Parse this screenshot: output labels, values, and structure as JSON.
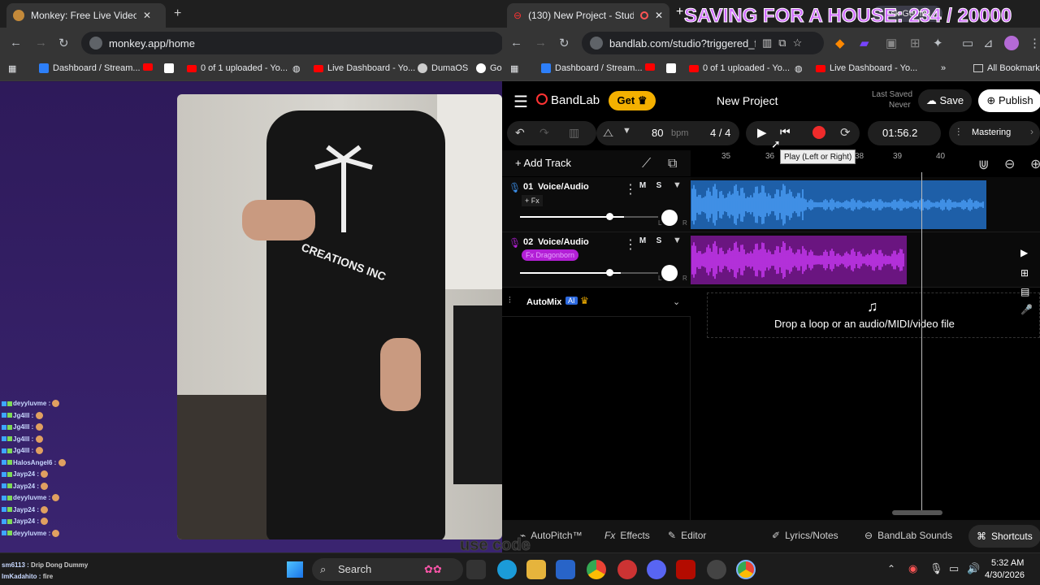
{
  "left_browser": {
    "tab_title": "Monkey: Free Live Video Ch",
    "url": "monkey.app/home",
    "bookmarks": [
      "Dashboard / Stream...",
      "0 of 1 uploaded - Yo...",
      "Live Dashboard - Yo...",
      "DumaOS",
      "Go"
    ]
  },
  "shirt_text": "CREATIONS INC",
  "chat": [
    {
      "user": "deyyluvme :",
      "msg": ""
    },
    {
      "user": "Jg4lll :",
      "msg": ""
    },
    {
      "user": "Jg4lll :",
      "msg": ""
    },
    {
      "user": "Jg4lll :",
      "msg": ""
    },
    {
      "user": "Jg4lll :",
      "msg": ""
    },
    {
      "user": "HalosAngel6 :",
      "msg": ""
    },
    {
      "user": "Jayp24 :",
      "msg": ""
    },
    {
      "user": "Jayp24 :",
      "msg": ""
    },
    {
      "user": "deyyluvme :",
      "msg": ""
    },
    {
      "user": "Jayp24 :",
      "msg": ""
    },
    {
      "user": "Jayp24 :",
      "msg": ""
    },
    {
      "user": "deyyluvme :",
      "msg": ""
    },
    {
      "user": "sm6113 :",
      "msg": "Drip Dong Dummy"
    },
    {
      "user": "lmKadahito :",
      "msg": "fire"
    }
  ],
  "overlay_text": "use code",
  "right_browser": {
    "tab_count_title": "(130) New Project - Studio",
    "url": "bandlab.com/studio?triggered_fr...",
    "stream_overlay": "SAVING FOR A HOUSE: 234 / 20000",
    "ask_gemini": "Ask Gemini",
    "bookmarks": [
      "Dashboard / Stream...",
      "0 of 1 uploaded - Yo...",
      "Live Dashboard - Yo..."
    ],
    "all_bookmarks": "All Bookmarks"
  },
  "bandlab": {
    "brand": "BandLab",
    "get_label": "Get",
    "project_name": "New Project",
    "last_saved_label": "Last Saved",
    "last_saved_value": "Never",
    "save_label": "Save",
    "publish_label": "Publish",
    "bpm_value": "80",
    "bpm_unit": "bpm",
    "time_sig": "4 / 4",
    "time": "01:56.2",
    "mastering_label": "Mastering",
    "tooltip": "Play (Left or Right)",
    "add_track_label": "Add Track",
    "ruler": [
      "35",
      "36",
      "38",
      "39",
      "40"
    ],
    "tracks": [
      {
        "num": "01",
        "name": "Voice/Audio",
        "fx": "+ Fx",
        "color": "#3b8ee8",
        "vol": 0.75
      },
      {
        "num": "02",
        "name": "Voice/Audio",
        "fx": "Fx Dragonborn",
        "color": "#b31fd6",
        "vol": 0.73
      }
    ],
    "automix_label": "AutoMix",
    "ai_badge": "AI",
    "drop_text": "Drop a loop or an audio/MIDI/video file",
    "bottom_tools": [
      "AutoPitch™",
      "Effects",
      "Editor",
      "Lyrics/Notes",
      "BandLab Sounds",
      "Shortcuts"
    ],
    "mute_label": "M",
    "solo_label": "S",
    "knob_l": "L",
    "knob_r": "R"
  },
  "taskbar": {
    "search_label": "Search",
    "time": "5:32 AM",
    "date": "4/30/2026"
  }
}
